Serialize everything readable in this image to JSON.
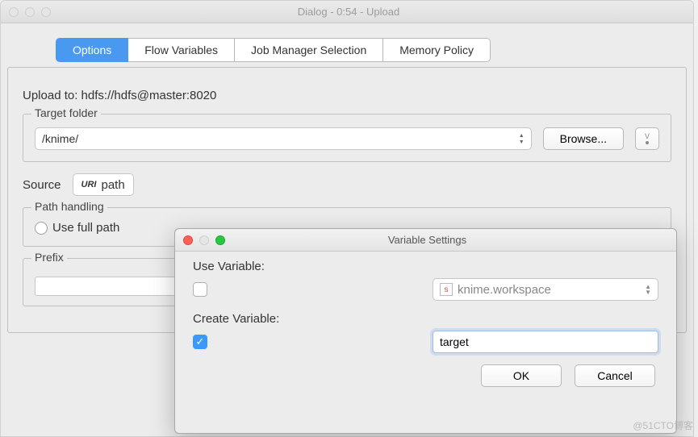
{
  "window": {
    "title": "Dialog - 0:54 - Upload"
  },
  "tabs": {
    "items": [
      "Options",
      "Flow Variables",
      "Job Manager Selection",
      "Memory Policy"
    ],
    "active": 0
  },
  "content": {
    "upload_to_label": "Upload to: hdfs://hdfs@master:8020",
    "target_folder": {
      "legend": "Target folder",
      "value": "/knime/",
      "browse_label": "Browse..."
    },
    "source": {
      "label": "Source",
      "uri_tag": "URI",
      "value": "path"
    },
    "path_handling": {
      "legend": "Path handling",
      "option1": "Use full path"
    },
    "prefix": {
      "legend": "Prefix"
    }
  },
  "dialog2": {
    "title": "Variable Settings",
    "use_variable_label": "Use Variable:",
    "use_variable_checked": false,
    "select_value": "knime.workspace",
    "create_variable_label": "Create Variable:",
    "create_variable_checked": true,
    "create_variable_value": "target",
    "ok_label": "OK",
    "cancel_label": "Cancel"
  },
  "watermark": "@51CTO博客"
}
